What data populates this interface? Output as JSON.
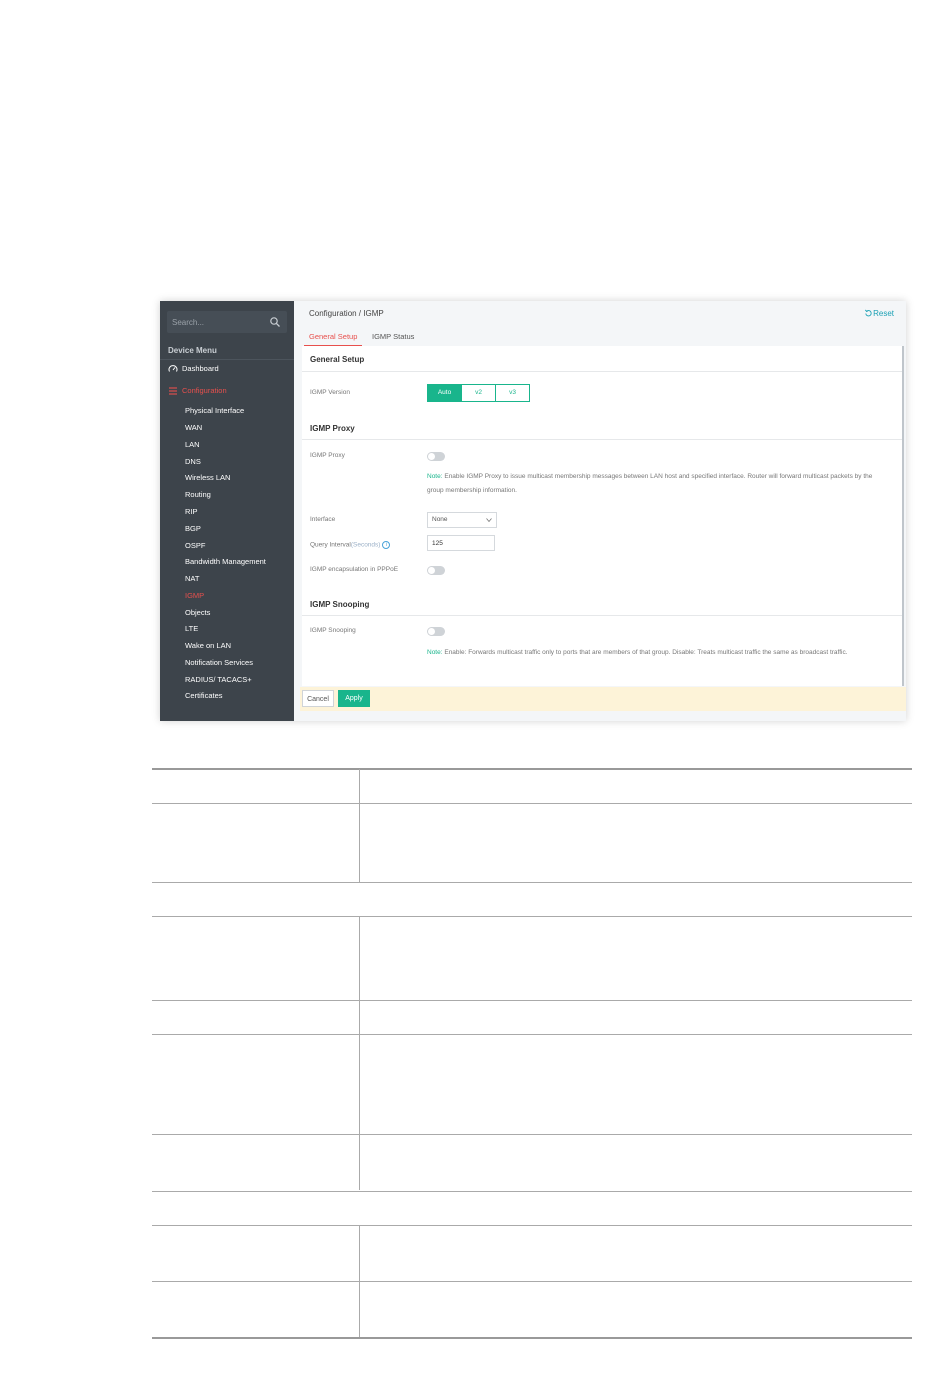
{
  "sidebar": {
    "search_placeholder": "Search...",
    "menu_title": "Device Menu",
    "dashboard": "Dashboard",
    "configuration": "Configuration",
    "items": [
      {
        "label": "Physical Interface"
      },
      {
        "label": "WAN"
      },
      {
        "label": "LAN"
      },
      {
        "label": "DNS"
      },
      {
        "label": "Wireless LAN"
      },
      {
        "label": "Routing"
      },
      {
        "label": "RIP"
      },
      {
        "label": "BGP"
      },
      {
        "label": "OSPF"
      },
      {
        "label": "Bandwidth Management"
      },
      {
        "label": "NAT"
      },
      {
        "label": "IGMP"
      },
      {
        "label": "Objects"
      },
      {
        "label": "LTE"
      },
      {
        "label": "Wake on LAN"
      },
      {
        "label": "Notification Services"
      },
      {
        "label": "RADIUS/ TACACS+"
      },
      {
        "label": "Certificates"
      }
    ],
    "active_item": "IGMP"
  },
  "header": {
    "breadcrumb": "Configuration / IGMP",
    "reset": "Reset"
  },
  "tabs": [
    {
      "label": "General Setup",
      "active": true
    },
    {
      "label": "IGMP Status",
      "active": false
    }
  ],
  "general_setup": {
    "title": "General Setup",
    "igmp_version_label": "IGMP Version",
    "version_options": [
      "Auto",
      "v2",
      "v3"
    ],
    "version_selected": "Auto"
  },
  "igmp_proxy": {
    "title": "IGMP Proxy",
    "proxy_label": "IGMP Proxy",
    "note_key": "Note:",
    "note_text": "Enable IGMP Proxy to issue multicast membership messages between LAN host and specified interface. Router will forward multicast packets by the group membership information.",
    "interface_label": "Interface",
    "interface_value": "None",
    "query_interval_label": "Query Interval",
    "query_interval_unit": "(Seconds)",
    "query_interval_value": "125",
    "pppoe_label": "IGMP encapsulation in PPPoE"
  },
  "igmp_snooping": {
    "title": "IGMP Snooping",
    "snooping_label": "IGMP Snooping",
    "note_key": "Note:",
    "note_text": "Enable: Forwards multicast traffic only to ports that are members of that group. Disable: Treats multicast traffic the same as broadcast traffic."
  },
  "footer": {
    "cancel": "Cancel",
    "apply": "Apply"
  },
  "colors": {
    "accent_green": "#19b58c",
    "active_red": "#e8504d",
    "sidebar_bg": "#3d444b",
    "reset_link": "#1aa0b4"
  }
}
